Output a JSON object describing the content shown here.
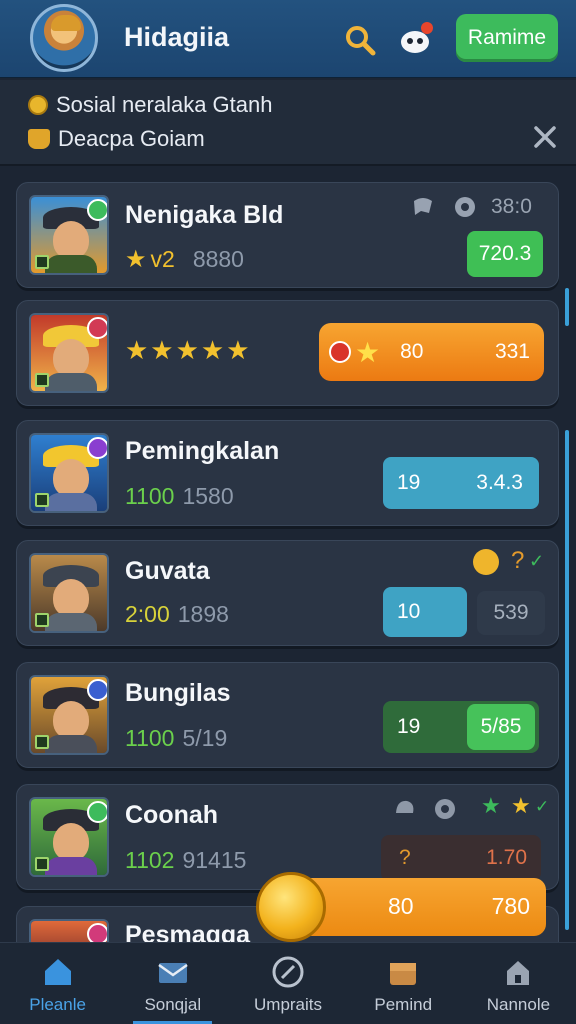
{
  "header": {
    "title": "Hidagiia",
    "action_button": "Ramime",
    "avatar_icon": "player-avatar",
    "search_icon": "search-icon",
    "bot_icon": "bot-icon"
  },
  "notice": {
    "line1": "Sosial neralaka Gtanh",
    "line2": "Deacpa Goiam"
  },
  "cards": [
    {
      "name": "Nenigaka Bld",
      "rating": "v2",
      "score": "8880",
      "time": "38:0",
      "pill": "720.3",
      "stars_full": 1
    },
    {
      "name": "",
      "stars_full": 5,
      "pill_left": "80",
      "pill_right": "331"
    },
    {
      "name": "Pemingkalan",
      "stat_a": "1100",
      "stat_b": "1580",
      "pill_left": "19",
      "pill_right": "3.4.3"
    },
    {
      "name": "Guvata",
      "stat_a": "2:00",
      "stat_b": "1898",
      "pill_left": "10",
      "pill_right": "539",
      "corner_text": "?"
    },
    {
      "name": "Bungilas",
      "stat_a": "1100",
      "stat_b": "5/19",
      "pill_left": "19",
      "pill_right": "5/85"
    },
    {
      "name": "Coonah",
      "stat_a": "1102",
      "stat_b": "91415",
      "pill_left": "?",
      "pill_right": "1.70"
    },
    {
      "name": "Pesmagga"
    }
  ],
  "reward_bar": {
    "left": "80",
    "right": "780"
  },
  "nav": [
    {
      "label": "Pleanle",
      "icon": "home-icon",
      "active": true
    },
    {
      "label": "Sonqjal",
      "icon": "mail-icon",
      "active": false
    },
    {
      "label": "Umpraits",
      "icon": "compass-icon",
      "active": false
    },
    {
      "label": "Pemind",
      "icon": "chest-icon",
      "active": false
    },
    {
      "label": "Nannole",
      "icon": "lock-icon",
      "active": false
    }
  ],
  "colors": {
    "accent_green": "#3dbb5c",
    "accent_orange": "#ec8a12",
    "accent_teal": "#3fa3c4",
    "header_blue": "#23527f",
    "background": "#1c2533"
  }
}
